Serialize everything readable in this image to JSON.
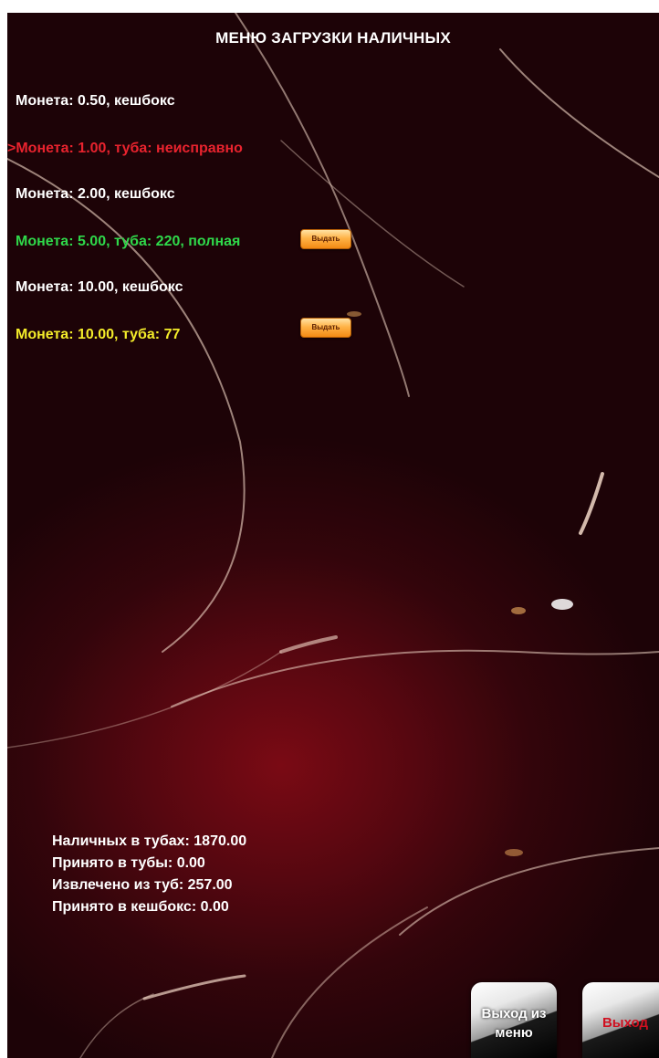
{
  "title": "МЕНЮ ЗАГРУЗКИ НАЛИЧНЫХ",
  "coins": [
    {
      "text": "Монета: 0.50, кешбокс",
      "color": "#ffffff"
    },
    {
      "text": ">Монета: 1.00, туба: неисправно",
      "color": "#e8232e"
    },
    {
      "text": "Монета: 2.00, кешбокс",
      "color": "#ffffff"
    },
    {
      "text": "Монета: 5.00, туба: 220, полная",
      "color": "#2fd84a",
      "button": "Выдать"
    },
    {
      "text": "Монета: 10.00, кешбокс",
      "color": "#ffffff"
    },
    {
      "text": "Монета: 10.00, туба: 77",
      "color": "#f4ec2a",
      "button": "Выдать"
    }
  ],
  "stats": {
    "cash_in_tubes": "Наличных в тубах: 1870.00",
    "accepted_to_tubes": "Принято в тубы: 0.00",
    "extracted_from_tubes": "Извлечено из туб: 257.00",
    "accepted_to_cashbox": "Принято в кешбокс: 0.00"
  },
  "buttons": {
    "exit_menu": [
      "Выход из",
      "меню"
    ],
    "exit": "Выход"
  }
}
